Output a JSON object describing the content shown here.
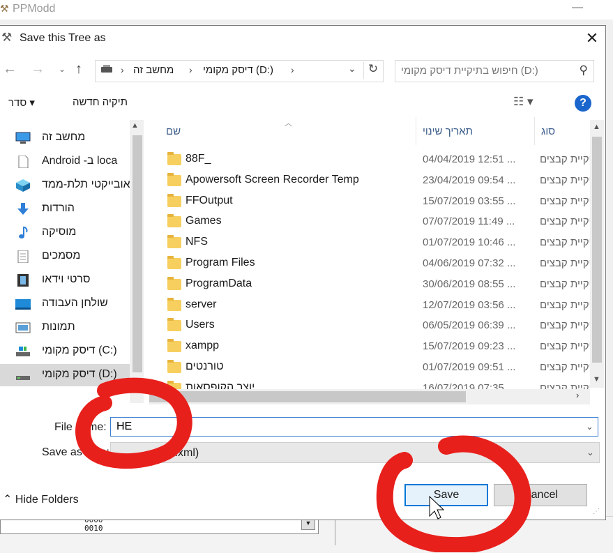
{
  "app": {
    "title": "PPModd"
  },
  "dialog": {
    "title": "Save this Tree as"
  },
  "address": {
    "segments": [
      "מחשב זה",
      "דיסק מקומי (D:)"
    ],
    "search_placeholder": "חיפוש בתיקיית דיסק מקומי (D:)"
  },
  "toolbar": {
    "organize": "סדר",
    "new_folder": "תיקיה חדשה"
  },
  "nav": {
    "items": [
      {
        "label": "מחשב זה",
        "icon": "computer-icon"
      },
      {
        "label": "Android -ב  loca",
        "icon": "document-icon"
      },
      {
        "label": "אובייקטי תלת-ממד",
        "icon": "cube-3d-icon"
      },
      {
        "label": "הורדות",
        "icon": "download-icon"
      },
      {
        "label": "מוסיקה",
        "icon": "music-icon"
      },
      {
        "label": "מסמכים",
        "icon": "documents-icon"
      },
      {
        "label": "סרטי וידאו",
        "icon": "video-icon"
      },
      {
        "label": "שולחן העבודה",
        "icon": "desktop-icon"
      },
      {
        "label": "תמונות",
        "icon": "pictures-icon"
      },
      {
        "label": "דיסק מקומי (C:)",
        "icon": "drive-c-icon"
      },
      {
        "label": "דיסק מקומי (D:)",
        "icon": "drive-d-icon",
        "selected": true
      }
    ]
  },
  "columns": {
    "name": "שם",
    "date": "תאריך שינוי",
    "type": "סוג"
  },
  "files": [
    {
      "name": "88F_",
      "date": "04/04/2019 12:51 ...",
      "type": "תיקיית קבצים"
    },
    {
      "name": "Apowersoft Screen Recorder Temp",
      "date": "23/04/2019 09:54 ...",
      "type": "תיקיית קבצים"
    },
    {
      "name": "FFOutput",
      "date": "15/07/2019 03:55 ...",
      "type": "תיקיית קבצים"
    },
    {
      "name": "Games",
      "date": "07/07/2019 11:49 ...",
      "type": "תיקיית קבצים"
    },
    {
      "name": "NFS",
      "date": "01/07/2019 10:46 ...",
      "type": "תיקיית קבצים"
    },
    {
      "name": "Program Files",
      "date": "04/06/2019 07:32 ...",
      "type": "תיקיית קבצים"
    },
    {
      "name": "ProgramData",
      "date": "30/06/2019 08:55 ...",
      "type": "תיקיית קבצים"
    },
    {
      "name": "server",
      "date": "12/07/2019 03:56 ...",
      "type": "תיקיית קבצים"
    },
    {
      "name": "Users",
      "date": "06/05/2019 06:39 ...",
      "type": "תיקיית קבצים"
    },
    {
      "name": "xampp",
      "date": "15/07/2019 09:23 ...",
      "type": "תיקיית קבצים"
    },
    {
      "name": "טורנטים",
      "date": "01/07/2019 09:51 ...",
      "type": "תיקיית קבצים"
    },
    {
      "name": "יוצר הקופסאות",
      "date": "16/07/2019 07:35 ...",
      "type": "תיקיית קבצים"
    }
  ],
  "form": {
    "file_name_label": "File name:",
    "file_name_value": "HE",
    "save_as_type_label": "Save as type:",
    "save_as_type_value": "(*.xml)"
  },
  "buttons": {
    "hide_folders": "Hide Folders",
    "save": "Save",
    "cancel": "Cancel"
  },
  "background": {
    "list_items": [
      "0000",
      "0010"
    ]
  },
  "colors": {
    "accent": "#0078d7",
    "annotation": "#e8201c",
    "folder": "#f7cf5f"
  }
}
